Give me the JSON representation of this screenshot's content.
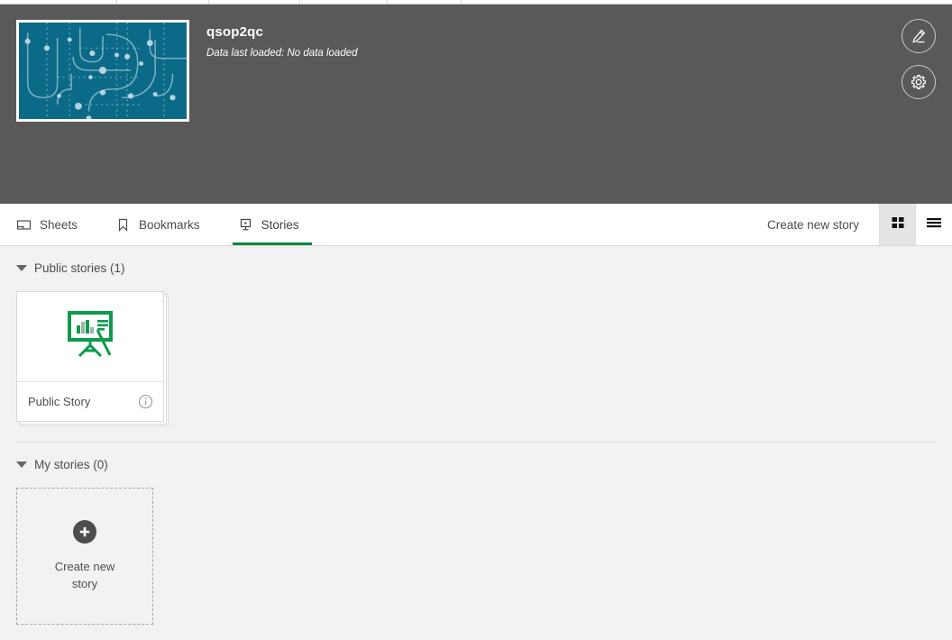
{
  "colors": {
    "header_bg": "#595959",
    "content_bg": "#f2f2f2",
    "accent_green": "#00873d",
    "story_icon_green": "#0d9a4e",
    "thumb_teal": "#0b6a87",
    "text": "#4d4d4d"
  },
  "app": {
    "title": "qsop2qc",
    "subtitle": "Data last loaded: No data loaded",
    "thumbnail_icon": "network-pattern-thumbnail",
    "edit_button": "edit-pencil-icon",
    "settings_button": "gear-icon"
  },
  "tabs": [
    {
      "label": "Sheets",
      "icon": "sheet-icon",
      "active": false
    },
    {
      "label": "Bookmarks",
      "icon": "bookmark-icon",
      "active": false
    },
    {
      "label": "Stories",
      "icon": "story-play-icon",
      "active": true
    }
  ],
  "toolbar": {
    "create_link": "Create new story",
    "grid_view_icon": "grid-view-icon",
    "list_view_icon": "list-view-icon",
    "active_view": "grid"
  },
  "sections": [
    {
      "title": "Public stories (1)",
      "expanded": true,
      "items": [
        {
          "name": "Public Story",
          "icon": "presentation-easel-icon",
          "info_icon": "info-circle-icon"
        }
      ]
    },
    {
      "title": "My stories (0)",
      "expanded": true,
      "items": []
    }
  ],
  "create_card": {
    "label": "Create new story",
    "icon": "plus-circle-icon"
  }
}
